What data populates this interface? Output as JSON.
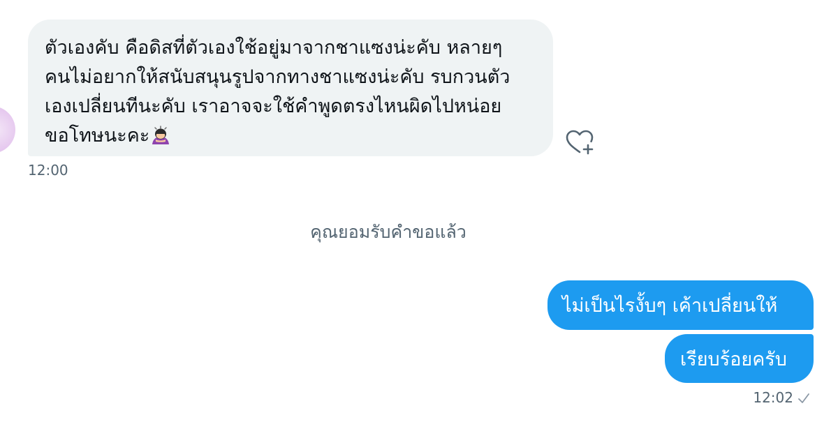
{
  "received_message": {
    "lines": [
      "ตัวเองคับ คือดิสที่ตัวเองใช้อยู่มาจากชาแซงน่ะคับ หลายๆ",
      "คนไม่อยากให้สนับสนุนรูปจากทางชาแซงน่ะคับ รบกวนตัว",
      "เองเปลี่ยนทีนะคับ เราอาจจะใช้คำพูดตรงไหนผิดไปหน่อย",
      "ขอโทษนะคะ"
    ],
    "emoji": "person-bowing-emoji",
    "timestamp": "12:00",
    "react_icon": "heart-plus-icon"
  },
  "system_notice": "คุณยอมรับคำขอแล้ว",
  "sent_messages": [
    {
      "text": "ไม่เป็นไรงั้บๆ เค้าเปลี่ยนให้"
    },
    {
      "text": "เรียบร้อยครับ"
    }
  ],
  "sent_timestamp": "12:02",
  "sent_status_icon": "check-icon",
  "colors": {
    "sent_bubble": "#1d9bf0",
    "received_bubble": "#eff3f4",
    "secondary_text": "#536471",
    "primary_text": "#0f1419"
  }
}
